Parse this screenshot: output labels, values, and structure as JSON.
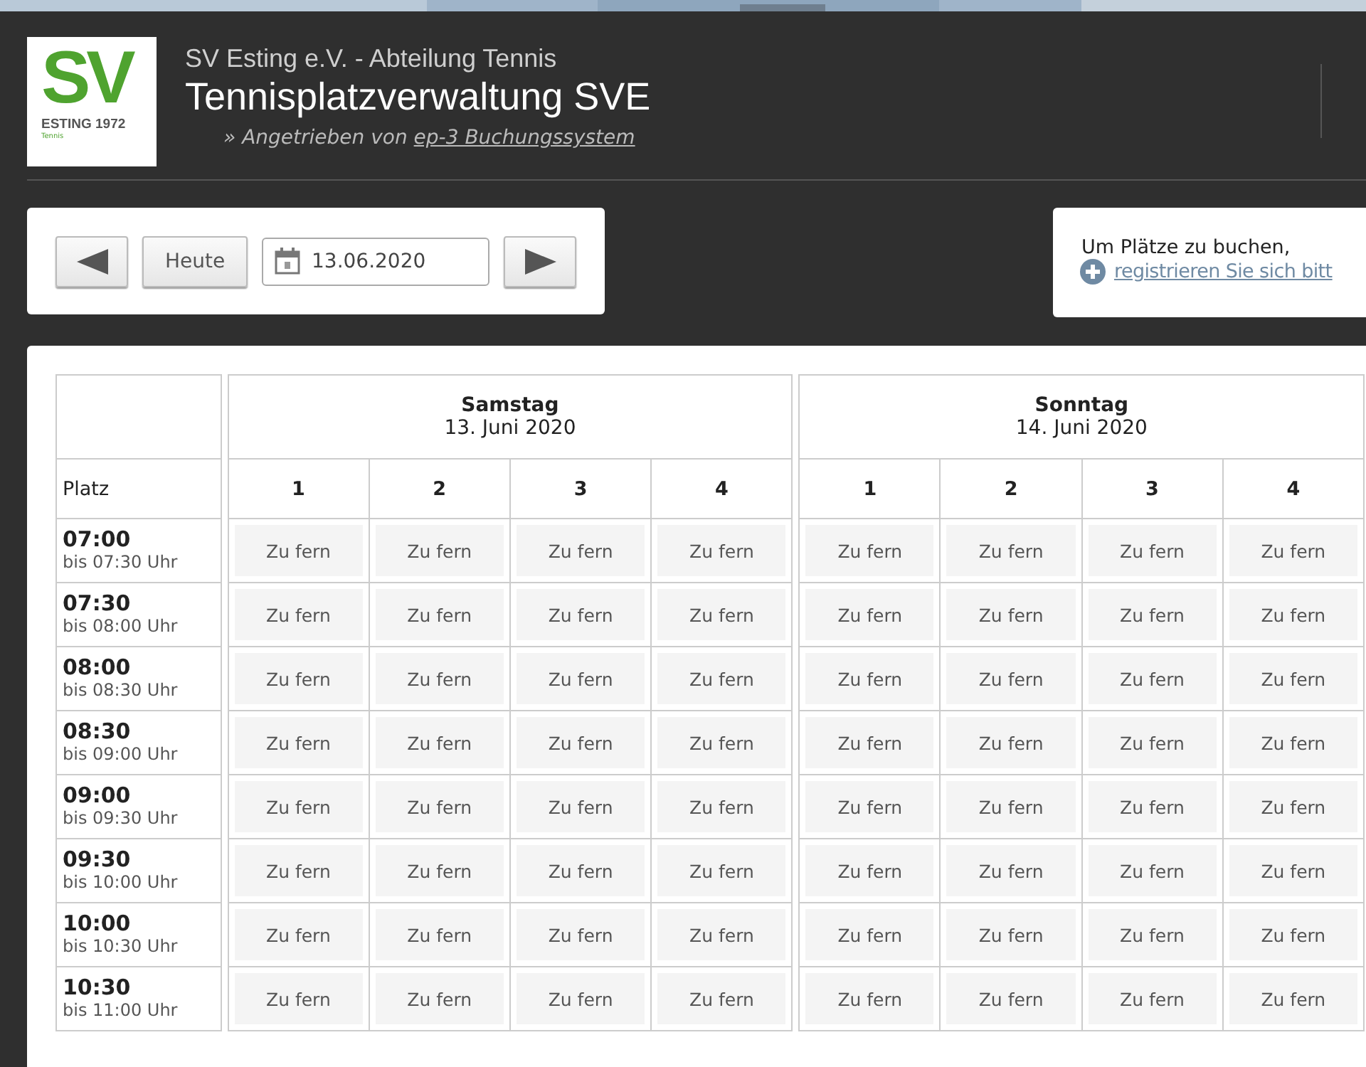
{
  "header": {
    "logo": {
      "letters": "SV",
      "name": "ESTING 1972",
      "sub": "Tennis"
    },
    "club": "SV Esting e.V. - Abteilung Tennis",
    "title": "Tennisplatzverwaltung SVE",
    "powered_prefix": "» Angetrieben von",
    "powered_link": "ep-3 Buchungssystem"
  },
  "nav": {
    "today": "Heute",
    "date": "13.06.2020"
  },
  "notice": {
    "text": "Um Plätze zu buchen,",
    "link": "registrieren Sie sich bitt"
  },
  "table": {
    "corner": "Platz",
    "days": [
      {
        "name": "Samstag",
        "date": "13. Juni 2020",
        "courts": [
          "1",
          "2",
          "3",
          "4"
        ]
      },
      {
        "name": "Sonntag",
        "date": "14. Juni 2020",
        "courts": [
          "1",
          "2",
          "3",
          "4"
        ]
      }
    ],
    "rows": [
      {
        "time": "07:00",
        "until": "bis 07:30 Uhr",
        "cells": [
          [
            "Zu fern",
            "Zu fern",
            "Zu fern",
            "Zu fern"
          ],
          [
            "Zu fern",
            "Zu fern",
            "Zu fern",
            "Zu fern"
          ]
        ]
      },
      {
        "time": "07:30",
        "until": "bis 08:00 Uhr",
        "cells": [
          [
            "Zu fern",
            "Zu fern",
            "Zu fern",
            "Zu fern"
          ],
          [
            "Zu fern",
            "Zu fern",
            "Zu fern",
            "Zu fern"
          ]
        ]
      },
      {
        "time": "08:00",
        "until": "bis 08:30 Uhr",
        "cells": [
          [
            "Zu fern",
            "Zu fern",
            "Zu fern",
            "Zu fern"
          ],
          [
            "Zu fern",
            "Zu fern",
            "Zu fern",
            "Zu fern"
          ]
        ]
      },
      {
        "time": "08:30",
        "until": "bis 09:00 Uhr",
        "cells": [
          [
            "Zu fern",
            "Zu fern",
            "Zu fern",
            "Zu fern"
          ],
          [
            "Zu fern",
            "Zu fern",
            "Zu fern",
            "Zu fern"
          ]
        ]
      },
      {
        "time": "09:00",
        "until": "bis 09:30 Uhr",
        "cells": [
          [
            "Zu fern",
            "Zu fern",
            "Zu fern",
            "Zu fern"
          ],
          [
            "Zu fern",
            "Zu fern",
            "Zu fern",
            "Zu fern"
          ]
        ]
      },
      {
        "time": "09:30",
        "until": "bis 10:00 Uhr",
        "cells": [
          [
            "Zu fern",
            "Zu fern",
            "Zu fern",
            "Zu fern"
          ],
          [
            "Zu fern",
            "Zu fern",
            "Zu fern",
            "Zu fern"
          ]
        ]
      },
      {
        "time": "10:00",
        "until": "bis 10:30 Uhr",
        "cells": [
          [
            "Zu fern",
            "Zu fern",
            "Zu fern",
            "Zu fern"
          ],
          [
            "Zu fern",
            "Zu fern",
            "Zu fern",
            "Zu fern"
          ]
        ]
      },
      {
        "time": "10:30",
        "until": "bis 11:00 Uhr",
        "cells": [
          [
            "Zu fern",
            "Zu fern",
            "Zu fern",
            "Zu fern"
          ],
          [
            "Zu fern",
            "Zu fern",
            "Zu fern",
            "Zu fern"
          ]
        ]
      }
    ]
  }
}
